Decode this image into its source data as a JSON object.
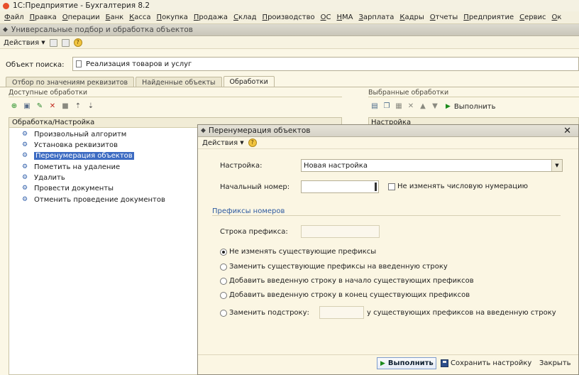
{
  "app_title": "1С:Предприятие - Бухгалтерия 8.2",
  "menu": [
    "Файл",
    "Правка",
    "Операции",
    "Банк",
    "Касса",
    "Покупка",
    "Продажа",
    "Склад",
    "Производство",
    "ОС",
    "НМА",
    "Зарплата",
    "Кадры",
    "Отчеты",
    "Предприятие",
    "Сервис",
    "Ок"
  ],
  "window_title": "Универсальные подбор и обработка объектов",
  "toolbar": {
    "actions_label": "Действия"
  },
  "search": {
    "label": "Объект поиска:",
    "value": "Реализация товаров и услуг"
  },
  "tabs": [
    "Отбор по значениям реквизитов",
    "Найденные объекты",
    "Обработки"
  ],
  "available": {
    "label": "Доступные обработки",
    "header": "Обработка/Настройка",
    "items": [
      "Произвольный алгоритм",
      "Установка реквизитов",
      "Перенумерация объектов",
      "Пометить на удаление",
      "Удалить",
      "Провести документы",
      "Отменить проведение документов"
    ]
  },
  "selected": {
    "label": "Выбранные обработки",
    "run_label": "Выполнить",
    "header": "Настройка"
  },
  "dialog": {
    "title": "Перенумерация объектов",
    "actions_label": "Действия",
    "setting_label": "Настройка:",
    "setting_value": "Новая настройка",
    "start_number_label": "Начальный номер:",
    "keep_numbering_label": "Не изменять числовую нумерацию",
    "prefix_group_title": "Префиксы номеров",
    "prefix_string_label": "Строка префикса:",
    "radio_options": [
      "Не изменять существующие префиксы",
      "Заменить существующие префиксы на введенную строку",
      "Добавить введенную строку в начало существующих префиксов",
      "Добавить введенную строку в конец существующих префиксов",
      "Заменить подстроку:"
    ],
    "radio_suffix": "у существующих префиксов на введенную строку",
    "run_button": "Выполнить",
    "save_button": "Сохранить настройку",
    "close_button": "Закрыть"
  }
}
